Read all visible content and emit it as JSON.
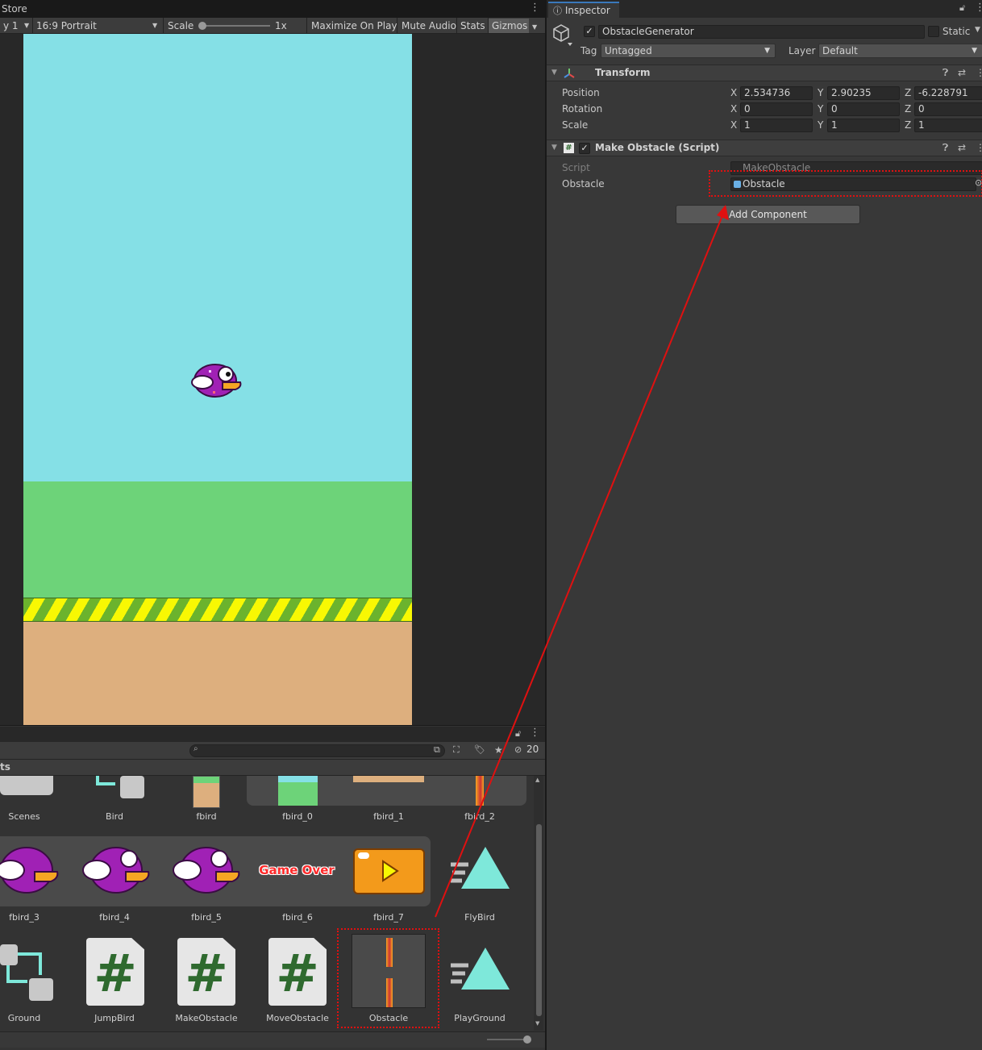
{
  "game": {
    "tab_label": "Store",
    "display_label": "y 1",
    "aspect_label": "16:9 Portrait",
    "scale_label": "Scale",
    "scale_value": "1x",
    "maximize_label": "Maximize On Play",
    "mute_label": "Mute Audio",
    "stats_label": "Stats",
    "gizmos_label": "Gizmos"
  },
  "inspector": {
    "tab_label": "Inspector",
    "object_name": "ObstacleGenerator",
    "static_label": "Static",
    "tag_label": "Tag",
    "tag_value": "Untagged",
    "layer_label": "Layer",
    "layer_value": "Default",
    "transform": {
      "title": "Transform",
      "position_label": "Position",
      "rotation_label": "Rotation",
      "scale_label": "Scale",
      "position": {
        "x": "2.534736",
        "y": "2.90235",
        "z": "-6.228791"
      },
      "rotation": {
        "x": "0",
        "y": "0",
        "z": "0"
      },
      "scale": {
        "x": "1",
        "y": "1",
        "z": "1"
      }
    },
    "make_obstacle": {
      "title": "Make Obstacle (Script)",
      "script_label": "Script",
      "script_value": "MakeObstacle",
      "obstacle_label": "Obstacle",
      "obstacle_value": "Obstacle"
    },
    "add_component_label": "Add Component",
    "axis_x": "X",
    "axis_y": "Y",
    "axis_z": "Z"
  },
  "project": {
    "breadcrumb": "ts",
    "hidden_count": "20",
    "assets": {
      "scenes": "Scenes",
      "bird": "Bird",
      "fbird": "fbird",
      "fbird_0": "fbird_0",
      "fbird_1": "fbird_1",
      "fbird_2": "fbird_2",
      "fbird_3": "fbird_3",
      "fbird_4": "fbird_4",
      "fbird_5": "fbird_5",
      "fbird_6": "fbird_6",
      "fbird_7": "fbird_7",
      "flybird": "FlyBird",
      "ground": "Ground",
      "jumpbird": "JumpBird",
      "makeobstacle": "MakeObstacle",
      "moveobstacle": "MoveObstacle",
      "obstacle": "Obstacle",
      "playground": "PlayGround"
    },
    "game_over_text": "Game Over",
    "script_glyph": "#"
  },
  "colors": {
    "annotation_red": "#e01010",
    "sky": "#85e0e6",
    "grass": "#6dd379",
    "dirt": "#ddaf7e",
    "bird_purple": "#a021b5",
    "selection_blue": "#3a79bb"
  },
  "icons": [
    "gameobject-cube-icon",
    "info-icon",
    "lock-icon",
    "kebab-menu-icon",
    "help-icon",
    "preset-icon",
    "transform-icon",
    "script-icon",
    "prefab-icon",
    "object-picker-icon",
    "search-icon",
    "eye-hidden-icon",
    "star-icon",
    "tag-icon",
    "filter-icon"
  ]
}
